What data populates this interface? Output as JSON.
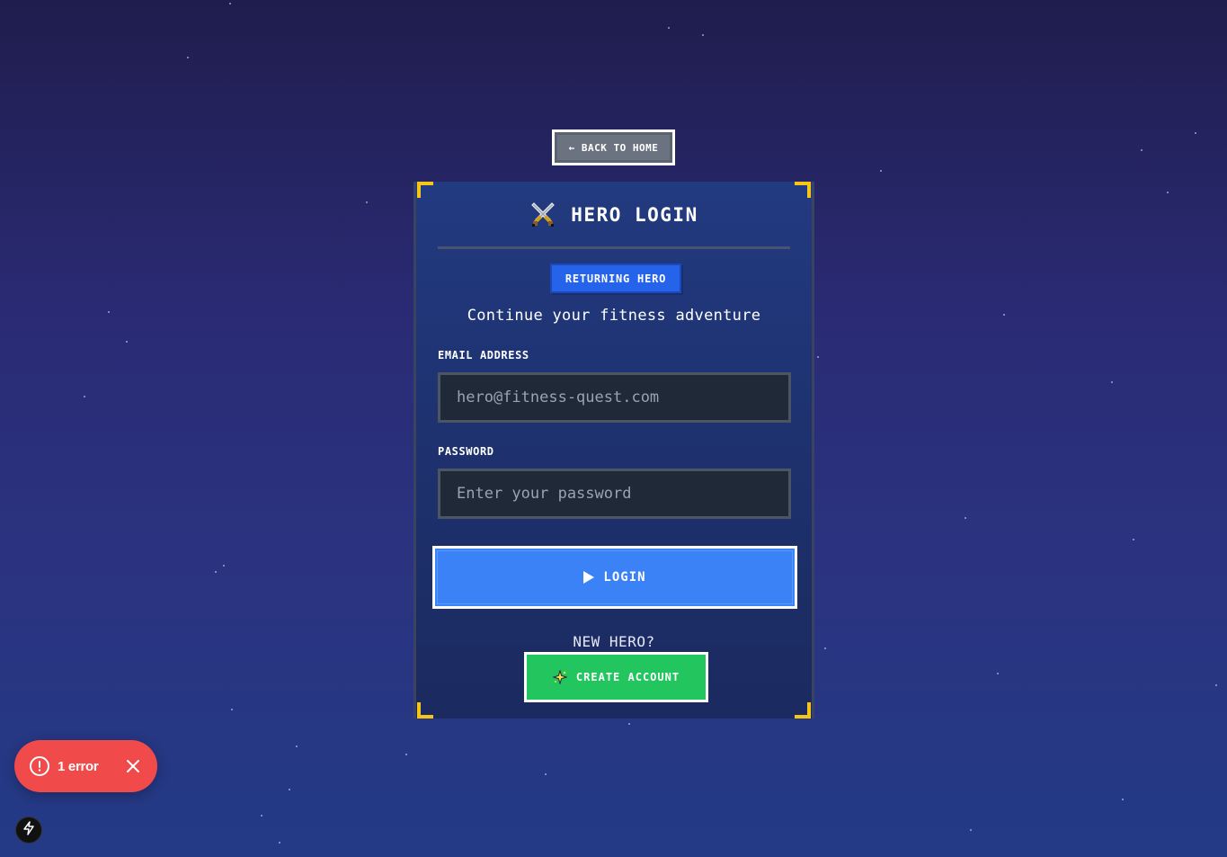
{
  "back_button": {
    "label": "← BACK TO HOME",
    "icon": "arrow-left-icon"
  },
  "card": {
    "title": "HERO LOGIN",
    "title_icon": "crossed-swords-icon",
    "badge": "RETURNING HERO",
    "subtitle": "Continue your fitness adventure",
    "email": {
      "label": "EMAIL ADDRESS",
      "value": "",
      "placeholder": "hero@fitness-quest.com"
    },
    "password": {
      "label": "PASSWORD",
      "value": "",
      "placeholder": "Enter your password"
    },
    "login_button": {
      "label": "LOGIN",
      "icon": "play-icon"
    },
    "signup_prompt": "NEW HERO?",
    "create_button": {
      "label": "CREATE ACCOUNT",
      "icon": "sparkle-icon"
    }
  },
  "error_toast": {
    "label": "1 error",
    "icon": "alert-circle-icon",
    "close_icon": "close-icon"
  },
  "dev_badge": {
    "icon": "lightning-icon"
  },
  "colors": {
    "accent_blue": "#3b82f6",
    "badge_blue": "#2563eb",
    "success_green": "#22c55e",
    "corner_gold": "#f5c518",
    "error_red": "#f04a4a"
  }
}
